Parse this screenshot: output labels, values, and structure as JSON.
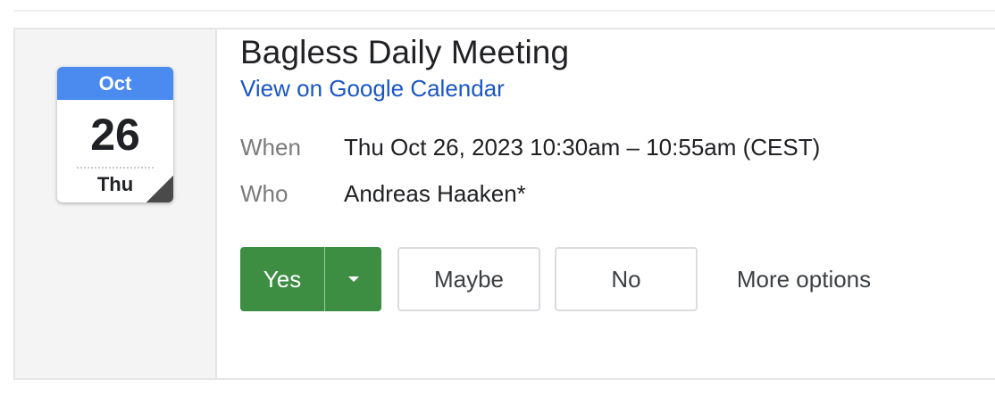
{
  "calendar_icon": {
    "month": "Oct",
    "day": "26",
    "weekday": "Thu",
    "colors": {
      "header": "#4b8bf0"
    }
  },
  "event": {
    "title": "Bagless Daily Meeting",
    "link_label": "View on Google Calendar",
    "when_label": "When",
    "when_value": "Thu Oct 26, 2023 10:30am – 10:55am (CEST)",
    "who_label": "Who",
    "who_value": "Andreas Haaken*"
  },
  "rsvp": {
    "yes_label": "Yes",
    "maybe_label": "Maybe",
    "no_label": "No",
    "more_label": "More options",
    "colors": {
      "yes": "#3d8d43",
      "link": "#1a56c4"
    }
  }
}
